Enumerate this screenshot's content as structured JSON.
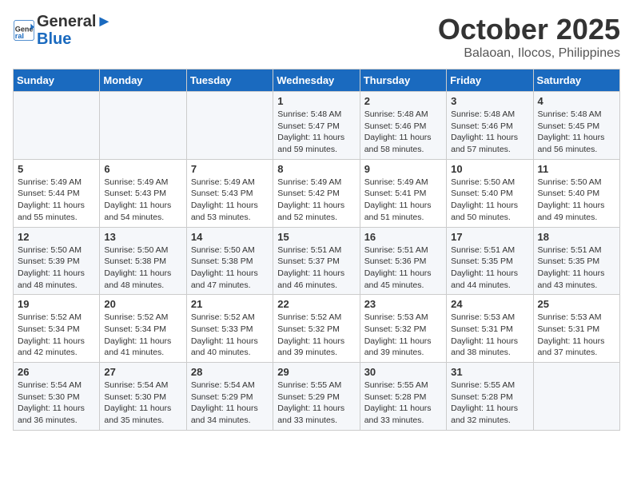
{
  "header": {
    "logo_line1": "General",
    "logo_line2": "Blue",
    "month": "October 2025",
    "location": "Balaoan, Ilocos, Philippines"
  },
  "weekdays": [
    "Sunday",
    "Monday",
    "Tuesday",
    "Wednesday",
    "Thursday",
    "Friday",
    "Saturday"
  ],
  "weeks": [
    [
      {
        "day": "",
        "content": ""
      },
      {
        "day": "",
        "content": ""
      },
      {
        "day": "",
        "content": ""
      },
      {
        "day": "1",
        "content": "Sunrise: 5:48 AM\nSunset: 5:47 PM\nDaylight: 11 hours\nand 59 minutes."
      },
      {
        "day": "2",
        "content": "Sunrise: 5:48 AM\nSunset: 5:46 PM\nDaylight: 11 hours\nand 58 minutes."
      },
      {
        "day": "3",
        "content": "Sunrise: 5:48 AM\nSunset: 5:46 PM\nDaylight: 11 hours\nand 57 minutes."
      },
      {
        "day": "4",
        "content": "Sunrise: 5:48 AM\nSunset: 5:45 PM\nDaylight: 11 hours\nand 56 minutes."
      }
    ],
    [
      {
        "day": "5",
        "content": "Sunrise: 5:49 AM\nSunset: 5:44 PM\nDaylight: 11 hours\nand 55 minutes."
      },
      {
        "day": "6",
        "content": "Sunrise: 5:49 AM\nSunset: 5:43 PM\nDaylight: 11 hours\nand 54 minutes."
      },
      {
        "day": "7",
        "content": "Sunrise: 5:49 AM\nSunset: 5:43 PM\nDaylight: 11 hours\nand 53 minutes."
      },
      {
        "day": "8",
        "content": "Sunrise: 5:49 AM\nSunset: 5:42 PM\nDaylight: 11 hours\nand 52 minutes."
      },
      {
        "day": "9",
        "content": "Sunrise: 5:49 AM\nSunset: 5:41 PM\nDaylight: 11 hours\nand 51 minutes."
      },
      {
        "day": "10",
        "content": "Sunrise: 5:50 AM\nSunset: 5:40 PM\nDaylight: 11 hours\nand 50 minutes."
      },
      {
        "day": "11",
        "content": "Sunrise: 5:50 AM\nSunset: 5:40 PM\nDaylight: 11 hours\nand 49 minutes."
      }
    ],
    [
      {
        "day": "12",
        "content": "Sunrise: 5:50 AM\nSunset: 5:39 PM\nDaylight: 11 hours\nand 48 minutes."
      },
      {
        "day": "13",
        "content": "Sunrise: 5:50 AM\nSunset: 5:38 PM\nDaylight: 11 hours\nand 48 minutes."
      },
      {
        "day": "14",
        "content": "Sunrise: 5:50 AM\nSunset: 5:38 PM\nDaylight: 11 hours\nand 47 minutes."
      },
      {
        "day": "15",
        "content": "Sunrise: 5:51 AM\nSunset: 5:37 PM\nDaylight: 11 hours\nand 46 minutes."
      },
      {
        "day": "16",
        "content": "Sunrise: 5:51 AM\nSunset: 5:36 PM\nDaylight: 11 hours\nand 45 minutes."
      },
      {
        "day": "17",
        "content": "Sunrise: 5:51 AM\nSunset: 5:35 PM\nDaylight: 11 hours\nand 44 minutes."
      },
      {
        "day": "18",
        "content": "Sunrise: 5:51 AM\nSunset: 5:35 PM\nDaylight: 11 hours\nand 43 minutes."
      }
    ],
    [
      {
        "day": "19",
        "content": "Sunrise: 5:52 AM\nSunset: 5:34 PM\nDaylight: 11 hours\nand 42 minutes."
      },
      {
        "day": "20",
        "content": "Sunrise: 5:52 AM\nSunset: 5:34 PM\nDaylight: 11 hours\nand 41 minutes."
      },
      {
        "day": "21",
        "content": "Sunrise: 5:52 AM\nSunset: 5:33 PM\nDaylight: 11 hours\nand 40 minutes."
      },
      {
        "day": "22",
        "content": "Sunrise: 5:52 AM\nSunset: 5:32 PM\nDaylight: 11 hours\nand 39 minutes."
      },
      {
        "day": "23",
        "content": "Sunrise: 5:53 AM\nSunset: 5:32 PM\nDaylight: 11 hours\nand 39 minutes."
      },
      {
        "day": "24",
        "content": "Sunrise: 5:53 AM\nSunset: 5:31 PM\nDaylight: 11 hours\nand 38 minutes."
      },
      {
        "day": "25",
        "content": "Sunrise: 5:53 AM\nSunset: 5:31 PM\nDaylight: 11 hours\nand 37 minutes."
      }
    ],
    [
      {
        "day": "26",
        "content": "Sunrise: 5:54 AM\nSunset: 5:30 PM\nDaylight: 11 hours\nand 36 minutes."
      },
      {
        "day": "27",
        "content": "Sunrise: 5:54 AM\nSunset: 5:30 PM\nDaylight: 11 hours\nand 35 minutes."
      },
      {
        "day": "28",
        "content": "Sunrise: 5:54 AM\nSunset: 5:29 PM\nDaylight: 11 hours\nand 34 minutes."
      },
      {
        "day": "29",
        "content": "Sunrise: 5:55 AM\nSunset: 5:29 PM\nDaylight: 11 hours\nand 33 minutes."
      },
      {
        "day": "30",
        "content": "Sunrise: 5:55 AM\nSunset: 5:28 PM\nDaylight: 11 hours\nand 33 minutes."
      },
      {
        "day": "31",
        "content": "Sunrise: 5:55 AM\nSunset: 5:28 PM\nDaylight: 11 hours\nand 32 minutes."
      },
      {
        "day": "",
        "content": ""
      }
    ]
  ]
}
